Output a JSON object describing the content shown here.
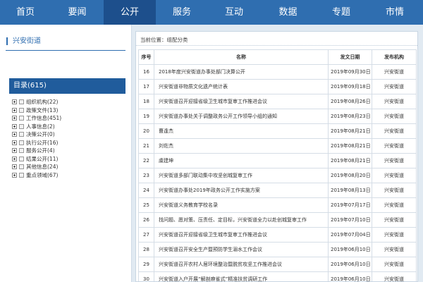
{
  "topnav": {
    "items": [
      {
        "label": "首页",
        "active": false
      },
      {
        "label": "要闻",
        "active": false
      },
      {
        "label": "公开",
        "active": true
      },
      {
        "label": "服务",
        "active": false
      },
      {
        "label": "互动",
        "active": false
      },
      {
        "label": "数据",
        "active": false
      },
      {
        "label": "专题",
        "active": false
      },
      {
        "label": "市情",
        "active": false
      }
    ],
    "bg_color": "#2f6eb0",
    "active_color": "#1d4f8c"
  },
  "sidebar": {
    "title": "兴安街道",
    "directory_label": "目录(615)",
    "tree": [
      {
        "label": "组织机构(22)"
      },
      {
        "label": "政策文件(13)"
      },
      {
        "label": "工作信息(451)"
      },
      {
        "label": "人事信息(2)"
      },
      {
        "label": "决策公开(0)"
      },
      {
        "label": "执行公开(16)"
      },
      {
        "label": "服务公开(4)"
      },
      {
        "label": "结果公开(11)"
      },
      {
        "label": "其他信息(24)"
      },
      {
        "label": "重点领域(67)"
      }
    ]
  },
  "main": {
    "breadcrumb": "当前位置：组配分类",
    "columns": {
      "no": "序号",
      "title": "名称",
      "date": "发文日期",
      "org": "发布机构"
    },
    "rows": [
      {
        "no": "16",
        "title": "2018年度兴安街道办事处部门决算公开",
        "date": "2019年09月30日",
        "org": "兴安街道"
      },
      {
        "no": "17",
        "title": "兴安街道非物质文化遗产统计表",
        "date": "2019年09月18日",
        "org": "兴安街道"
      },
      {
        "no": "18",
        "title": "兴安街道召开迎接省级卫生城市复审工作推进会议",
        "date": "2019年08月26日",
        "org": "兴安街道"
      },
      {
        "no": "19",
        "title": "兴安街道办事处关于调整政务公开工作领导小组的通知",
        "date": "2019年08月23日",
        "org": "兴安街道"
      },
      {
        "no": "20",
        "title": "曹逢杰",
        "date": "2019年08月21日",
        "org": "兴安街道"
      },
      {
        "no": "21",
        "title": "刘佐杰",
        "date": "2019年08月21日",
        "org": "兴安街道"
      },
      {
        "no": "22",
        "title": "虞建坤",
        "date": "2019年08月21日",
        "org": "兴安街道"
      },
      {
        "no": "23",
        "title": "兴安街道多部门联动集中攻坚创城复审工作",
        "date": "2019年08月20日",
        "org": "兴安街道"
      },
      {
        "no": "24",
        "title": "兴安街道办事处2019年政务公开工作实施方案",
        "date": "2019年08月13日",
        "org": "兴安街道"
      },
      {
        "no": "25",
        "title": "兴安街道义务教育学校名录",
        "date": "2019年07月17日",
        "org": "兴安街道"
      },
      {
        "no": "26",
        "title": "找问题、愿对策、压责任、定目标，兴安街道全力以赴创城复审工作",
        "date": "2019年07月10日",
        "org": "兴安街道"
      },
      {
        "no": "27",
        "title": "兴安街道召开迎接省级卫生城市复审工作推进会议",
        "date": "2019年07月04日",
        "org": "兴安街道"
      },
      {
        "no": "28",
        "title": "兴安街道召开安全生产暨预防学生溺水工作会议",
        "date": "2019年06月10日",
        "org": "兴安街道"
      },
      {
        "no": "29",
        "title": "兴安街道召开农村人居环境整治暨脱贫攻坚工作推进会议",
        "date": "2019年06月10日",
        "org": "兴安街道"
      },
      {
        "no": "30",
        "title": "兴安街道入户开展“解剖麻雀式”精准扶贫调研工作",
        "date": "2019年06月10日",
        "org": "兴安街道"
      }
    ]
  }
}
